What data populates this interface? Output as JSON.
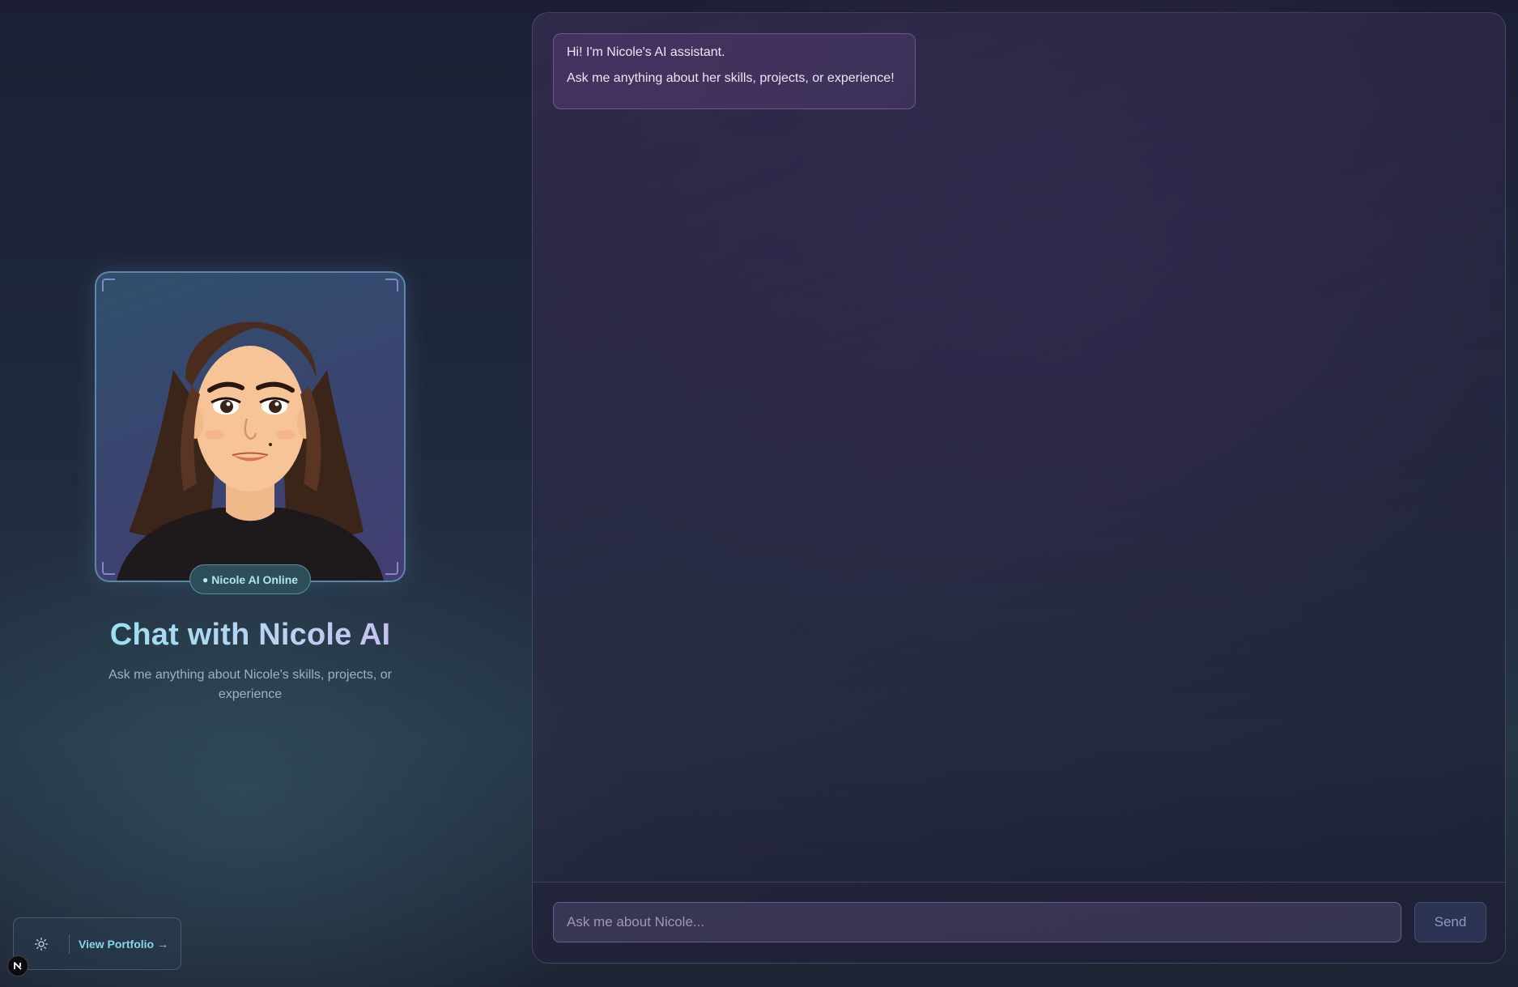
{
  "profile": {
    "status_dot": "●",
    "status_text": "Nicole AI Online",
    "title": "Chat with Nicole AI",
    "subtitle": "Ask me anything about Nicole's skills, projects, or experience"
  },
  "footer": {
    "theme_icon": "sun-icon",
    "portfolio_label": "View Portfolio →",
    "badge_letter": "N"
  },
  "chat": {
    "messages": [
      {
        "role": "assistant",
        "lines": [
          "Hi! I'm Nicole's AI assistant.",
          "Ask me anything about her skills, projects, or experience!"
        ]
      }
    ],
    "input_placeholder": "Ask me about Nicole...",
    "input_value": "",
    "send_label": "Send"
  },
  "colors": {
    "accent_cyan": "#8fe4f0",
    "accent_violet": "#cdb6f2",
    "online_badge": "#2d4e58"
  }
}
